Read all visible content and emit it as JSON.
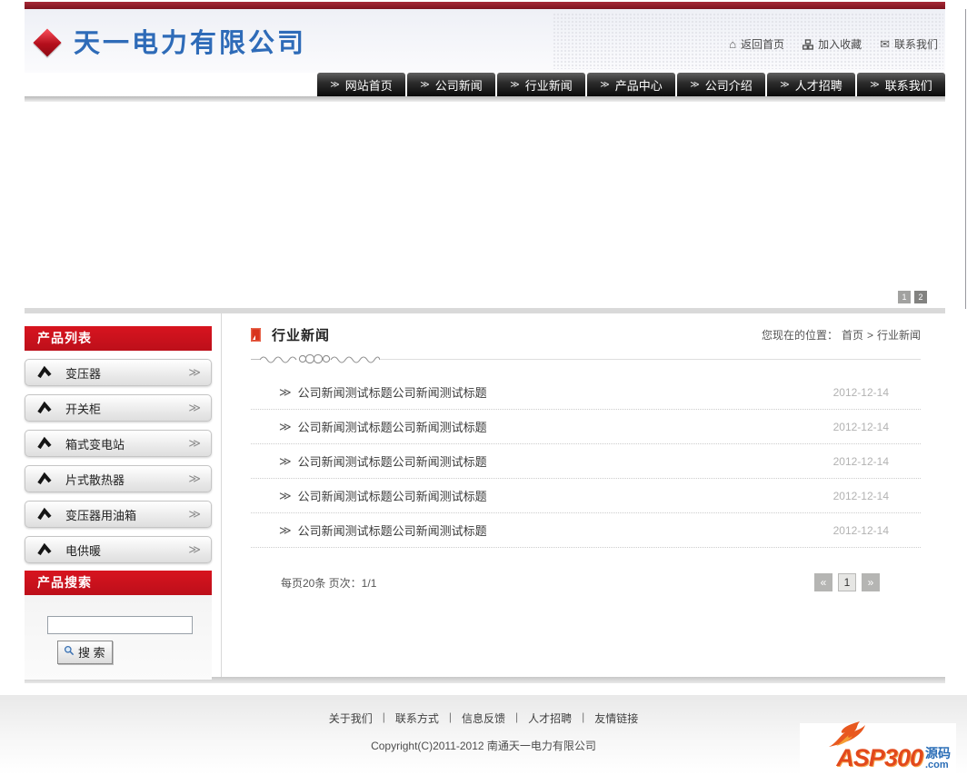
{
  "header": {
    "company_name": "天一电力有限公司",
    "top_links": [
      {
        "label": "返回首页"
      },
      {
        "label": "加入收藏"
      },
      {
        "label": "联系我们"
      }
    ]
  },
  "icons": {
    "home_glyph": "⌂",
    "mail_glyph": "✉"
  },
  "nav": {
    "arrow_glyph": "≫",
    "items": [
      "网站首页",
      "公司新闻",
      "行业新闻",
      "产品中心",
      "公司介绍",
      "人才招聘",
      "联系我们"
    ]
  },
  "banner": {
    "pages": [
      "1",
      "2"
    ]
  },
  "sidebar": {
    "list_title": "产品列表",
    "categories": [
      "变压器",
      "开关柜",
      "箱式变电站",
      "片式散热器",
      "变压器用油箱",
      "电供暖"
    ],
    "more_glyph": "≫",
    "search_title": "产品搜索",
    "search_value": "",
    "search_button": "搜 索"
  },
  "main": {
    "title": "行业新闻",
    "breadcrumb": {
      "prefix": "您现在的位置：",
      "home": "首页",
      "sep": ">",
      "current": "行业新闻"
    },
    "news_arrow": "≫",
    "news": [
      {
        "title": "公司新闻测试标题公司新闻测试标题",
        "date": "2012-12-14"
      },
      {
        "title": "公司新闻测试标题公司新闻测试标题",
        "date": "2012-12-14"
      },
      {
        "title": "公司新闻测试标题公司新闻测试标题",
        "date": "2012-12-14"
      },
      {
        "title": "公司新闻测试标题公司新闻测试标题",
        "date": "2012-12-14"
      },
      {
        "title": "公司新闻测试标题公司新闻测试标题",
        "date": "2012-12-14"
      }
    ],
    "page_info": "每页20条 页次：1/1",
    "pager": {
      "prev": "«",
      "page": "1",
      "next": "»"
    }
  },
  "footer": {
    "links": [
      "关于我们",
      "联系方式",
      "信息反馈",
      "人才招聘",
      "友情链接"
    ],
    "sep": "|",
    "copyright": "Copyright(C)2011-2012 南通天一电力有限公司",
    "badge": {
      "name": "ASP300",
      "word": "源码",
      "domain": ".com"
    }
  },
  "colors": {
    "accent_red": "#c8101c",
    "dark_red": "#8c1b25",
    "logo_blue": "#2e6bb8",
    "nav_black": "#111111"
  }
}
